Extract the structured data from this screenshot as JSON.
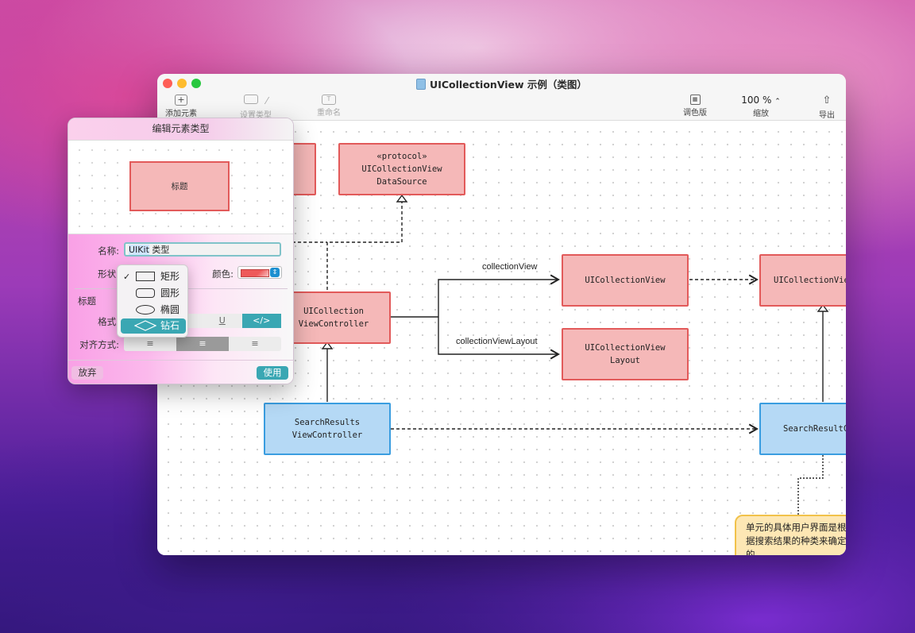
{
  "window": {
    "title": "UICollectionView 示例（类图）",
    "toolbar": {
      "add_element": "添加元素",
      "set_type": "设置类型",
      "rename": "重命名",
      "palette": "调色版",
      "zoom_value": "100 %",
      "zoom_label": "缩放",
      "export": "导出"
    }
  },
  "diagram": {
    "nodes": {
      "datasource": [
        "«protocol»",
        "UICollectionView",
        "DataSource"
      ],
      "vc": [
        "UICollection",
        "ViewController"
      ],
      "cv": [
        "UICollectionView"
      ],
      "cv_right": [
        "UICollectionVie"
      ],
      "layout": [
        "UICollectionView",
        "Layout"
      ],
      "search_vc": [
        "SearchResults",
        "ViewController"
      ],
      "search_right": [
        "SearchResultC"
      ]
    },
    "edge_labels": {
      "collection_view": "collectionView",
      "collection_view_layout": "collectionViewLayout"
    },
    "note": "单元的具体用户界面是根据搜索结果的种类来确定的。"
  },
  "panel": {
    "title": "编辑元素类型",
    "preview_label": "标题",
    "name_label": "名称:",
    "name_value_selected": "UIKit",
    "name_value_rest": " 类型",
    "shape_label": "形状:",
    "color_label": "颜色:",
    "section_title": "标题",
    "format_label": "格式:",
    "format_underline": "U",
    "format_code": "</>",
    "align_label": "对齐方式:",
    "discard_button": "放弃",
    "use_button": "使用",
    "shape_menu": {
      "checkmark": "✓",
      "items": [
        "矩形",
        "圆形",
        "椭圆",
        "钻石"
      ],
      "checked": "矩形",
      "highlighted": "钻石"
    }
  }
}
